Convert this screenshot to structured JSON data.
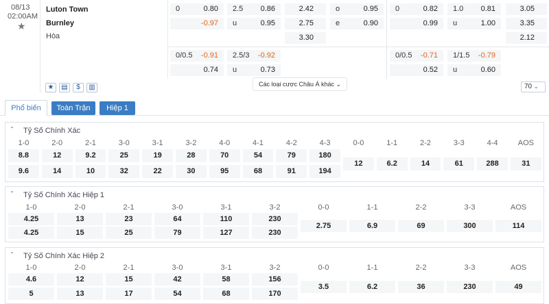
{
  "match": {
    "date": "08/13",
    "time": "02:00AM",
    "home": "Luton Town",
    "away": "Burnley",
    "draw": "Hòa"
  },
  "odds": {
    "hdp1": {
      "line1": "0",
      "home": "0.80",
      "line2": "",
      "away": "-0.97"
    },
    "ou1": {
      "line1": "2.5",
      "over": "0.86",
      "line2": "u",
      "under": "0.95"
    },
    "x12": {
      "home": "2.42",
      "away": "2.75",
      "draw": "3.30"
    },
    "oe": {
      "o_label": "o",
      "o_val": "0.95",
      "e_label": "e",
      "e_val": "0.90"
    },
    "hdp2": {
      "line1": "0",
      "home": "0.82",
      "away": "0.99"
    },
    "ou2": {
      "line1": "1.0",
      "over": "0.81",
      "line2": "u",
      "under": "1.00"
    },
    "x12_2": {
      "home": "3.05",
      "away": "3.35",
      "draw": "2.12"
    },
    "hdp3": {
      "line1": "0/0.5",
      "home": "-0.91",
      "away": "0.74"
    },
    "ou3": {
      "line1": "2.5/3",
      "over": "-0.92",
      "line2": "u",
      "under": "0.73"
    },
    "hdp4": {
      "line1": "0/0.5",
      "home": "-0.71",
      "away": "0.52"
    },
    "ou4": {
      "line1": "1/1.5",
      "over": "-0.79",
      "line2": "u",
      "under": "0.60"
    }
  },
  "more_bets_label": "Các loại cược Châu Á khác",
  "more_count": "70",
  "tabs": [
    "Phổ biến",
    "Toàn Trận",
    "Hiệp 1"
  ],
  "colors": {
    "accent": "#3b7dc4",
    "negative": "#e0651a",
    "panel_bg": "#f4f6f8"
  },
  "panels": [
    {
      "title": "Tỷ Số Chính Xác",
      "headers": [
        "1-0",
        "2-0",
        "2-1",
        "3-0",
        "3-1",
        "3-2",
        "4-0",
        "4-1",
        "4-2",
        "4-3",
        "0-0",
        "1-1",
        "2-2",
        "3-3",
        "4-4",
        "AOS"
      ],
      "row1": [
        "8.8",
        "12",
        "9.2",
        "25",
        "19",
        "28",
        "70",
        "54",
        "79",
        "180"
      ],
      "row2": [
        "9.6",
        "14",
        "10",
        "32",
        "22",
        "30",
        "95",
        "68",
        "91",
        "194"
      ],
      "mid": [
        "12",
        "6.2",
        "14",
        "61",
        "288",
        "31"
      ]
    },
    {
      "title": "Tỷ Số Chính Xác Hiệp 1",
      "headers": [
        "1-0",
        "2-0",
        "2-1",
        "3-0",
        "3-1",
        "3-2",
        "0-0",
        "1-1",
        "2-2",
        "3-3",
        "AOS"
      ],
      "row1": [
        "4.25",
        "13",
        "23",
        "64",
        "110",
        "230"
      ],
      "row2": [
        "4.25",
        "15",
        "25",
        "79",
        "127",
        "230"
      ],
      "mid": [
        "2.75",
        "6.9",
        "69",
        "300",
        "114"
      ]
    },
    {
      "title": "Tỷ Số Chính Xác Hiệp 2",
      "headers": [
        "1-0",
        "2-0",
        "2-1",
        "3-0",
        "3-1",
        "3-2",
        "0-0",
        "1-1",
        "2-2",
        "3-3",
        "AOS"
      ],
      "row1": [
        "4.6",
        "12",
        "15",
        "42",
        "58",
        "156"
      ],
      "row2": [
        "5",
        "13",
        "17",
        "54",
        "68",
        "170"
      ],
      "mid": [
        "3.5",
        "6.2",
        "36",
        "230",
        "49"
      ]
    }
  ]
}
